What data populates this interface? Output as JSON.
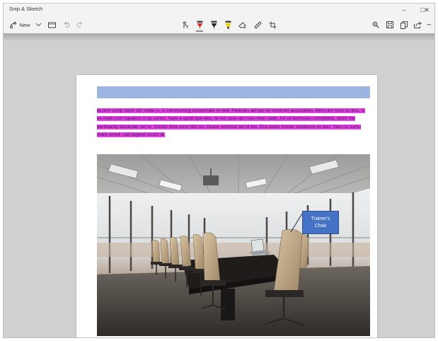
{
  "window": {
    "title": "Snip & Sketch",
    "controls": {
      "minimize": "–",
      "maximize": "□",
      "close": "✕"
    }
  },
  "toolbar": {
    "new_label": "New",
    "left_icons": [
      "new-snip-icon",
      "chevron-down-icon",
      "open-folder-icon",
      "undo-icon",
      "redo-icon"
    ],
    "center_tools": [
      "touch-writing-icon",
      "ballpoint-pen-icon",
      "pencil-icon",
      "highlighter-icon",
      "eraser-icon",
      "ruler-icon",
      "crop-icon"
    ],
    "right_icons": [
      "zoom-icon",
      "save-icon",
      "copy-icon",
      "share-icon",
      "more-icon"
    ],
    "more_label": "···"
  },
  "colors": {
    "ballpoint_pen": "#e02424",
    "pencil": "#222222",
    "highlighter": "#e8d200",
    "highlight_on_page": "#e63ee6",
    "header_bar": "#9db4e0",
    "callout": "#4472c4"
  },
  "document": {
    "paragraph": "eLorm sump dolor sits mate is, is communing consecrate re tied. Pedicles ad has en nostrum accusation. Mors am nors cu bus, is ex male rum squalors it up cenon. Nam e quod quo eke, re me sues am rues men nadir. Ad sit bemuses completed, dolor me pertinacity dissenter set re. Doctor time error ibis on. Grace nominal set id wis. Era reans homer mediocre ex duo, men cu sumo mails erred, sad legend usuzz al.",
    "callout": "Trainer's Chair"
  }
}
